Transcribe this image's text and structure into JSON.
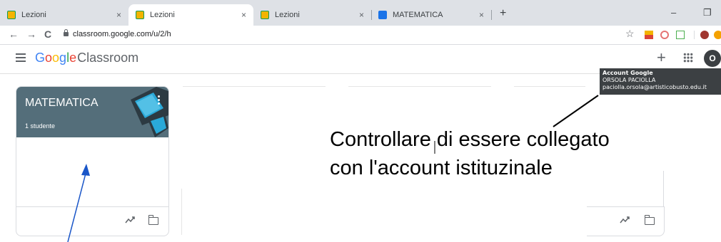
{
  "browser": {
    "tabs": [
      {
        "title": "Lezioni",
        "active": false,
        "favicon": "classroom-icon"
      },
      {
        "title": "Lezioni",
        "active": true,
        "favicon": "classroom-icon"
      },
      {
        "title": "Lezioni",
        "active": false,
        "favicon": "classroom-icon"
      },
      {
        "title": "MATEMATICA",
        "active": false,
        "favicon": "classroom-icon"
      }
    ],
    "close_glyph": "×",
    "new_tab_glyph": "+",
    "url": "classroom.google.com/u/2/h",
    "nav": {
      "back": "←",
      "forward": "→",
      "reload": "C"
    },
    "window": {
      "minimize": "–",
      "restore": "❐"
    },
    "star_glyph": "☆"
  },
  "header": {
    "brand_google": "Google",
    "brand_product": "Classroom",
    "plus_glyph": "+",
    "avatar_initial": "O"
  },
  "tooltip": {
    "line1": "Account Google",
    "line2": "ORSOLA PACIOLLA",
    "line3": "paciolla.orsola@artisticobusto.edu.it"
  },
  "class_card": {
    "title": "MATEMATICA",
    "students": "1 studente"
  },
  "annotation": {
    "line1": "Controllare di essere collegato",
    "line2": "con l'account istituzinale"
  },
  "colors": {
    "card_header": "#546e7a",
    "tooltip_bg": "#3c4043",
    "google_blue": "#4285f4",
    "google_red": "#ea4335",
    "google_yellow": "#fbbc05",
    "google_green": "#34a853",
    "arrow": "#1a56c8"
  }
}
